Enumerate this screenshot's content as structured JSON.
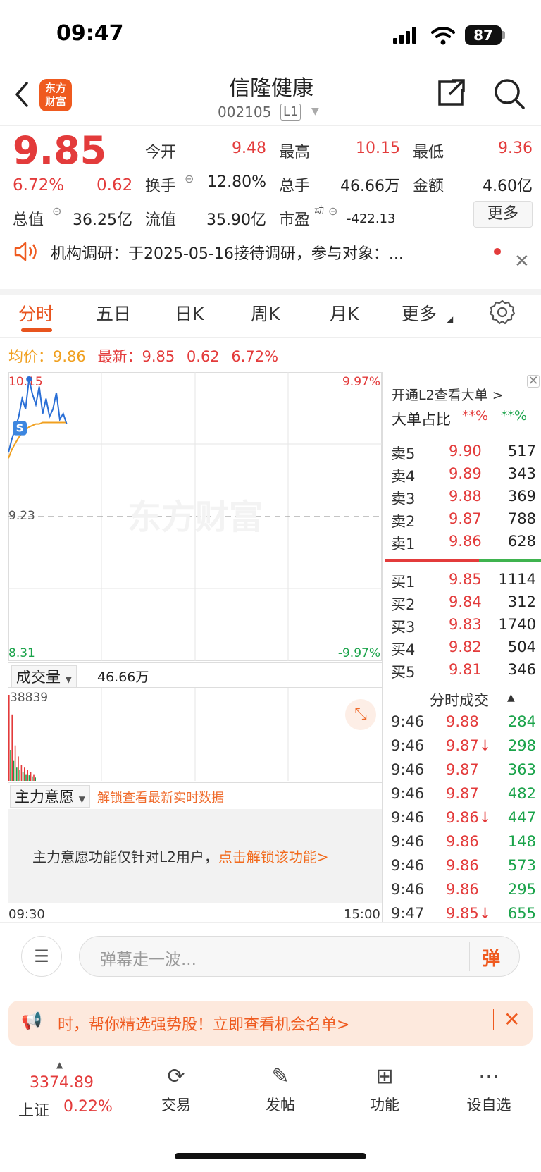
{
  "status_bar": {
    "time": "09:47",
    "battery": "87"
  },
  "header": {
    "logo_text_1": "东方",
    "logo_text_2": "财富",
    "stock_name": "信隆健康",
    "stock_code": "002105",
    "level_badge": "L1"
  },
  "quote": {
    "price": "9.85",
    "change_pct": "6.72%",
    "change": "0.62",
    "fields": [
      {
        "label": "今开",
        "value": "9.48",
        "color": "red"
      },
      {
        "label": "最高",
        "value": "10.15",
        "color": "red"
      },
      {
        "label": "最低",
        "value": "9.36",
        "color": "red"
      },
      {
        "label": "换手",
        "value": "12.80%",
        "color": "dark"
      },
      {
        "label": "总手",
        "value": "46.66万",
        "color": "dark"
      },
      {
        "label": "金额",
        "value": "4.60亿",
        "color": "dark"
      },
      {
        "label": "总值",
        "value": "36.25亿",
        "color": "dark"
      },
      {
        "label": "流值",
        "value": "35.90亿",
        "color": "dark"
      },
      {
        "label": "市盈",
        "value": "-422.13",
        "color": "dark"
      }
    ],
    "pe_superscript": "动",
    "more_label": "更多"
  },
  "notice": {
    "text": "机构调研：于2025-05-16接待调研，参与对象：..."
  },
  "tabs": [
    "分时",
    "五日",
    "日K",
    "周K",
    "月K",
    "更多"
  ],
  "avg_row": {
    "avg_label": "均价：",
    "avg_value": "9.86",
    "latest_label": "最新：",
    "latest_value": "9.85",
    "latest_change": "0.62",
    "latest_pct": "6.72%"
  },
  "chart_data": {
    "type": "line",
    "y_labels": {
      "high": "10.15",
      "mid": "9.23",
      "low": "8.31",
      "high_pct": "9.97%",
      "low_pct": "-9.97%"
    },
    "ylim": [
      8.31,
      10.15
    ],
    "prev_close": 9.23,
    "x_labels": [
      "09:30",
      "15:00"
    ],
    "price_series": [
      9.66,
      9.75,
      9.82,
      9.9,
      10.02,
      9.95,
      10.15,
      10.05,
      9.98,
      10.1,
      9.92,
      10.02,
      9.9,
      9.95,
      10.06,
      9.88,
      9.92,
      9.85
    ],
    "avg_series": [
      9.62,
      9.68,
      9.72,
      9.76,
      9.79,
      9.81,
      9.83,
      9.84,
      9.85,
      9.85,
      9.86,
      9.86,
      9.86,
      9.86,
      9.86,
      9.86,
      9.86,
      9.86
    ],
    "total_minutes": 240,
    "volume": {
      "label": "成交量",
      "total": "46.66万",
      "peak": "38839",
      "bars": [
        38839,
        14000,
        30000,
        9000,
        16000,
        6000,
        11000,
        5000,
        7000,
        4000,
        6000,
        3000,
        5000,
        2500,
        4000,
        2000,
        3000,
        1500
      ],
      "up": [
        true,
        false,
        true,
        false,
        true,
        false,
        true,
        false,
        true,
        false,
        true,
        false,
        true,
        false,
        true,
        false,
        true,
        false
      ]
    },
    "watermark": "东方财富"
  },
  "main_force": {
    "label": "主力意愿",
    "unlock_link": "解锁查看最新实时数据",
    "message": "主力意愿功能仅针对L2用户，",
    "message_link": "点击解锁该功能>"
  },
  "order_book": {
    "l2_open": "开通L2查看大单 >",
    "big_order_label": "大单占比",
    "big_order_red": "**%",
    "big_order_green": "**%",
    "asks": [
      {
        "label": "卖5",
        "price": "9.90",
        "vol": "517"
      },
      {
        "label": "卖4",
        "price": "9.89",
        "vol": "343"
      },
      {
        "label": "卖3",
        "price": "9.88",
        "vol": "369"
      },
      {
        "label": "卖2",
        "price": "9.87",
        "vol": "788"
      },
      {
        "label": "卖1",
        "price": "9.86",
        "vol": "628"
      }
    ],
    "bids": [
      {
        "label": "买1",
        "price": "9.85",
        "vol": "1114"
      },
      {
        "label": "买2",
        "price": "9.84",
        "vol": "312"
      },
      {
        "label": "买3",
        "price": "9.83",
        "vol": "1740"
      },
      {
        "label": "买4",
        "price": "9.82",
        "vol": "504"
      },
      {
        "label": "买5",
        "price": "9.81",
        "vol": "346"
      }
    ]
  },
  "trades": {
    "title": "分时成交",
    "rows": [
      {
        "time": "9:46",
        "price": "9.88",
        "vol": "284"
      },
      {
        "time": "9:46",
        "price": "9.87↓",
        "vol": "298"
      },
      {
        "time": "9:46",
        "price": "9.87",
        "vol": "363"
      },
      {
        "time": "9:46",
        "price": "9.87",
        "vol": "482"
      },
      {
        "time": "9:46",
        "price": "9.86↓",
        "vol": "447"
      },
      {
        "time": "9:46",
        "price": "9.86",
        "vol": "148"
      },
      {
        "time": "9:46",
        "price": "9.86",
        "vol": "573"
      },
      {
        "time": "9:46",
        "price": "9.86",
        "vol": "295"
      },
      {
        "time": "9:47",
        "price": "9.85↓",
        "vol": "655"
      }
    ]
  },
  "bullet": {
    "placeholder": "弹幕走一波...",
    "send": "弹"
  },
  "promo": {
    "text": "时，帮你精选强势股！立即查看机会名单>"
  },
  "bottom_nav": {
    "index_value": "3374.89",
    "index_name": "上证",
    "index_pct": "0.22%",
    "items": [
      {
        "label": "交易",
        "icon": "trade-icon"
      },
      {
        "label": "发帖",
        "icon": "post-icon"
      },
      {
        "label": "功能",
        "icon": "grid-icon"
      },
      {
        "label": "设自选",
        "icon": "more-icon"
      }
    ]
  }
}
